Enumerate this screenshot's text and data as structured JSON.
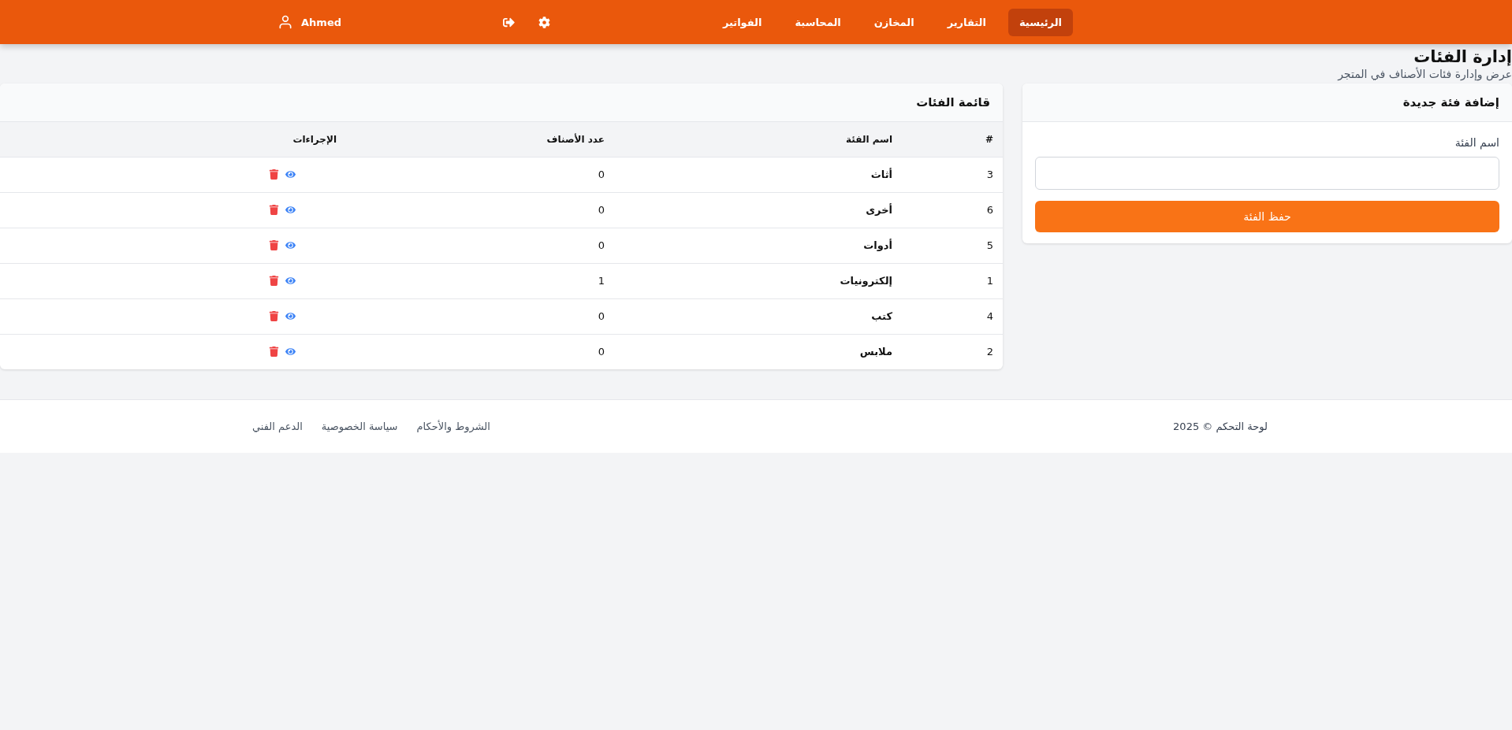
{
  "header": {
    "user": "Ahmed",
    "nav": [
      {
        "label": "الرئيسية",
        "selected": true
      },
      {
        "label": "التقارير",
        "selected": false
      },
      {
        "label": "المخازن",
        "selected": false
      },
      {
        "label": "المحاسبة",
        "selected": false
      },
      {
        "label": "الفواتير",
        "selected": false
      }
    ]
  },
  "page": {
    "title": "إدارة الفئات",
    "subtitle": "عرض وإدارة فئات الأصناف في المتجر"
  },
  "form": {
    "title": "إضافة فئة جديدة",
    "label": "اسم الفئة",
    "button": "حفظ الفئة"
  },
  "table": {
    "title": "قائمة الفئات",
    "columns": [
      "#",
      "اسم الفئة",
      "عدد الأصناف",
      "الإجراءات"
    ],
    "rows": [
      {
        "id": "3",
        "name": "أثاث",
        "count": "0"
      },
      {
        "id": "6",
        "name": "أخرى",
        "count": "0"
      },
      {
        "id": "5",
        "name": "أدوات",
        "count": "0"
      },
      {
        "id": "1",
        "name": "إلكترونيات",
        "count": "1"
      },
      {
        "id": "4",
        "name": "كتب",
        "count": "0"
      },
      {
        "id": "2",
        "name": "ملابس",
        "count": "0"
      }
    ]
  },
  "footer": {
    "copyright": "لوحة التحكم © 2025",
    "links": [
      "الشروط والأحكام",
      "سياسة الخصوصية",
      "الدعم الفني"
    ]
  }
}
